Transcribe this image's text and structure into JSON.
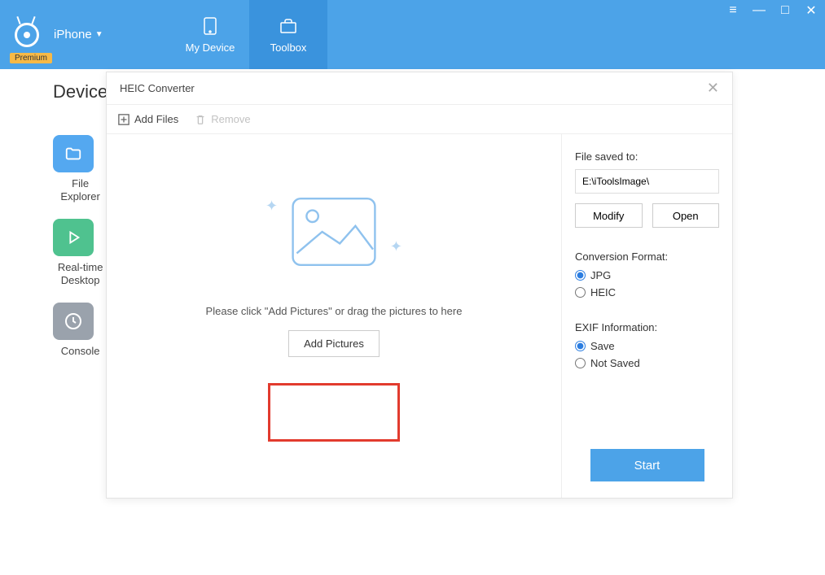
{
  "header": {
    "device_label": "iPhone",
    "premium_badge": "Premium",
    "tabs": {
      "my_device": "My Device",
      "toolbox": "Toolbox"
    }
  },
  "background": {
    "section_title": "Device",
    "tiles": [
      {
        "label": "File\nExplorer"
      },
      {
        "label": "Real-time\nDesktop"
      },
      {
        "label": "Console"
      }
    ]
  },
  "dialog": {
    "title": "HEIC Converter",
    "toolbar": {
      "add_files": "Add Files",
      "remove": "Remove"
    },
    "drop_area": {
      "instruction": "Please click \"Add Pictures\" or drag the pictures to here",
      "add_button": "Add Pictures"
    },
    "side": {
      "save_to_label": "File saved to:",
      "save_path": "E:\\iToolsImage\\",
      "modify_btn": "Modify",
      "open_btn": "Open",
      "format_label": "Conversion Format:",
      "format_options": {
        "jpg": "JPG",
        "heic": "HEIC"
      },
      "format_selected": "jpg",
      "exif_label": "EXIF Information:",
      "exif_options": {
        "save": "Save",
        "not_saved": "Not Saved"
      },
      "exif_selected": "save",
      "start_btn": "Start"
    }
  }
}
